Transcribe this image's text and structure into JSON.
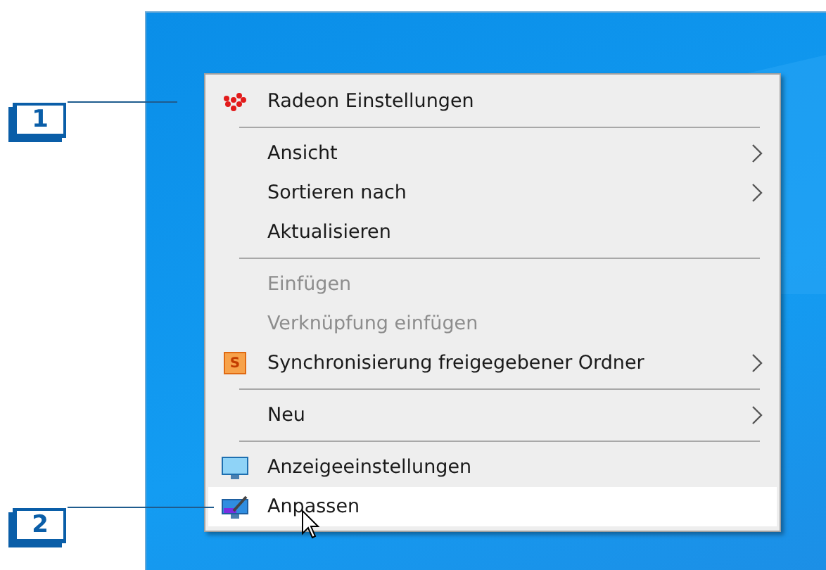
{
  "callouts": [
    {
      "label": "1"
    },
    {
      "label": "2"
    }
  ],
  "menu": {
    "items": [
      {
        "kind": "dots",
        "label": "Radeon Einstellungen",
        "disabled": false,
        "submenu": false,
        "selected": false
      },
      {
        "kind": "separator"
      },
      {
        "kind": "plain",
        "label": "Ansicht",
        "disabled": false,
        "submenu": true,
        "selected": false
      },
      {
        "kind": "plain",
        "label": "Sortieren nach",
        "disabled": false,
        "submenu": true,
        "selected": false
      },
      {
        "kind": "plain",
        "label": "Aktualisieren",
        "disabled": false,
        "submenu": false,
        "selected": false
      },
      {
        "kind": "separator"
      },
      {
        "kind": "plain",
        "label": "Einfügen",
        "disabled": true,
        "submenu": false,
        "selected": false
      },
      {
        "kind": "plain",
        "label": "Verknüpfung einfügen",
        "disabled": true,
        "submenu": false,
        "selected": false
      },
      {
        "kind": "letter",
        "label": "Synchronisierung freigegebener Ordner",
        "icon_text": "S",
        "disabled": false,
        "submenu": true,
        "selected": false
      },
      {
        "kind": "separator"
      },
      {
        "kind": "plain",
        "label": "Neu",
        "disabled": false,
        "submenu": true,
        "selected": false
      },
      {
        "kind": "separator"
      },
      {
        "kind": "monitor",
        "label": "Anzeigeeinstellungen",
        "disabled": false,
        "submenu": false,
        "selected": false
      },
      {
        "kind": "brush",
        "label": "Anpassen",
        "disabled": false,
        "submenu": false,
        "selected": true
      }
    ]
  }
}
